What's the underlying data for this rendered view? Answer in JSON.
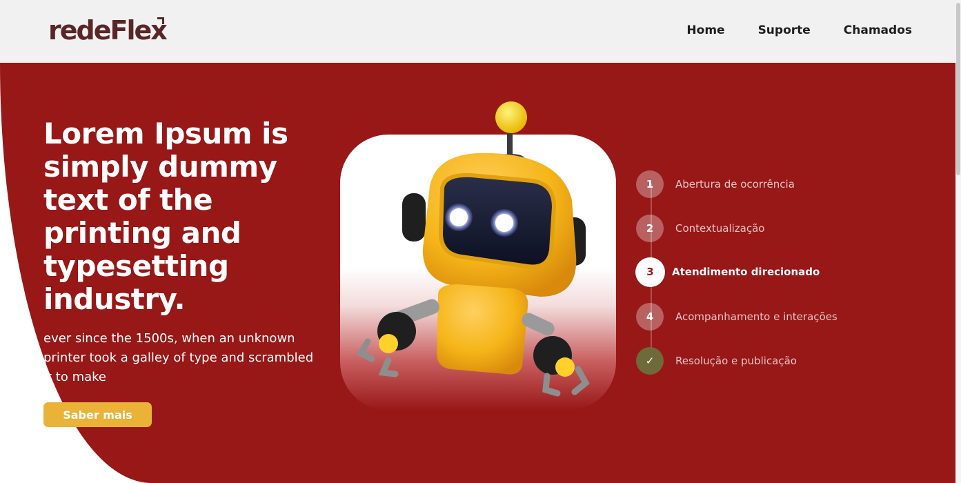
{
  "header": {
    "logo_text": "redeFlex",
    "nav": [
      "Home",
      "Suporte",
      "Chamados"
    ]
  },
  "hero": {
    "headline": "Lorem Ipsum is simply dummy text of the printing and typesetting industry.",
    "subtext": "ever since the 1500s, when an unknown printer took a galley of type and scrambled it to make",
    "cta_label": "Saber mais"
  },
  "steps": [
    {
      "marker": "1",
      "label": "Abertura de ocorrência",
      "state": "default"
    },
    {
      "marker": "2",
      "label": "Contextualização",
      "state": "default"
    },
    {
      "marker": "3",
      "label": "Atendimento direcionado",
      "state": "active"
    },
    {
      "marker": "4",
      "label": "Acompanhamento e interações",
      "state": "default"
    },
    {
      "marker": "✓",
      "label": "Resolução e publicação",
      "state": "done"
    }
  ],
  "colors": {
    "brand_red": "#981717",
    "cta_yellow": "#eab236",
    "header_bg": "#f1f1f1",
    "robot_yellow": "#f5b519"
  },
  "icons": {
    "hero_image": "robot-illustration",
    "done_step": "check-icon"
  }
}
